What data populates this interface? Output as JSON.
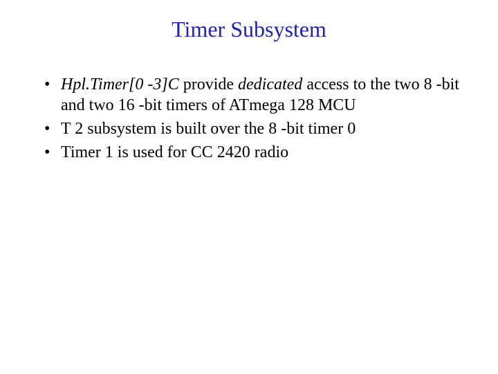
{
  "title": "Timer Subsystem",
  "bullets": {
    "item0": {
      "seg0": "Hpl.Timer[0 -3]C",
      "seg1": " provide ",
      "seg2": "dedicated",
      "seg3": " access to the two 8 -bit and two 16 -bit timers of ATmega 128 MCU"
    },
    "item1": "T 2 subsystem is built over the 8 -bit timer 0",
    "item2": "Timer 1 is used for CC 2420 radio"
  }
}
